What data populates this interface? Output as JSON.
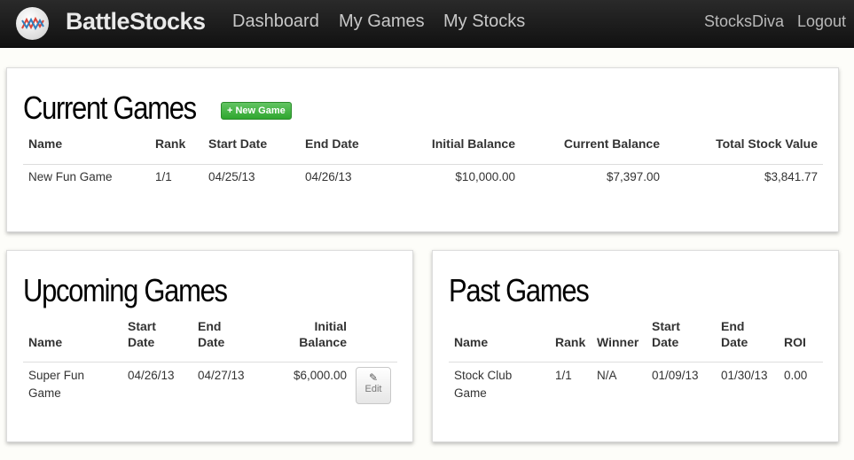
{
  "navbar": {
    "brand": "BattleStocks",
    "links": [
      "Dashboard",
      "My Games",
      "My Stocks"
    ],
    "user": "StocksDiva",
    "logout": "Logout"
  },
  "current_games": {
    "title": "Current Games",
    "new_game_label": "+ New Game",
    "columns": [
      "Name",
      "Rank",
      "Start Date",
      "End Date",
      "Initial Balance",
      "Current Balance",
      "Total Stock Value"
    ],
    "rows": [
      [
        "New Fun Game",
        "1/1",
        "04/25/13",
        "04/26/13",
        "$10,000.00",
        "$7,397.00",
        "$3,841.77"
      ]
    ]
  },
  "upcoming_games": {
    "title": "Upcoming Games",
    "columns": [
      "Name",
      "Start Date",
      "End Date",
      "Initial Balance"
    ],
    "rows": [
      {
        "name": "Super Fun Game",
        "start": "04/26/13",
        "end": "04/27/13",
        "balance": "$6,000.00",
        "edit_label": "Edit"
      }
    ]
  },
  "past_games": {
    "title": "Past Games",
    "columns": [
      "Name",
      "Rank",
      "Winner",
      "Start Date",
      "End Date",
      "ROI"
    ],
    "rows": [
      [
        "Stock Club Game",
        "1/1",
        "N/A",
        "01/09/13",
        "01/30/13",
        "0.00"
      ]
    ]
  },
  "colors": {
    "navbar": "#1a1a1a",
    "success": "#3fb33f",
    "logo_red": "#d9463a",
    "logo_blue": "#2f7fbf"
  }
}
